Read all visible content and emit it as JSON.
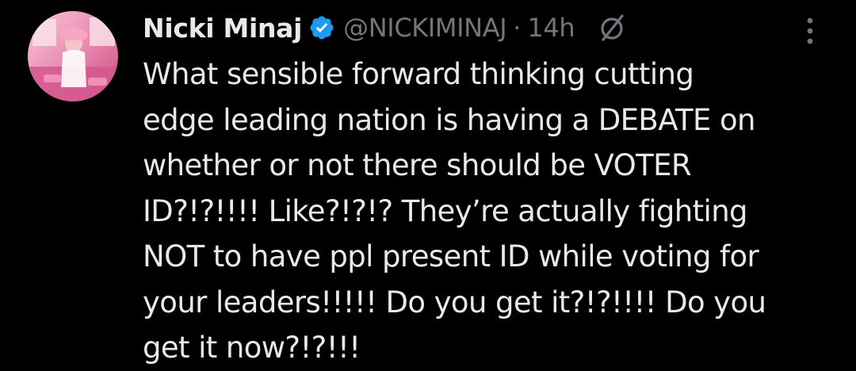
{
  "tweet": {
    "author": {
      "display_name": "Nicki Minaj",
      "handle": "@NICKIMINAJ",
      "verified": true,
      "avatar_icon": "profile-photo"
    },
    "separator": "·",
    "timestamp": "14h",
    "icons": {
      "verified": "verified-badge-icon",
      "status": "mute-icon",
      "more": "more-options-icon"
    },
    "text": "What sensible forward thinking cutting\nedge leading nation is having a DEBATE on\nwhether or not there should be VOTER\nID?!?!!!! Like?!?!? They’re actually fighting\nNOT to have ppl present ID while voting for\nyour leaders!!!!! Do you get it?!?!!!! Do you\nget it now?!?!!!"
  },
  "colors": {
    "background": "#000000",
    "primary_text": "#e7e9ea",
    "secondary_text": "#71767b",
    "verified_badge": "#1d9bf0"
  }
}
